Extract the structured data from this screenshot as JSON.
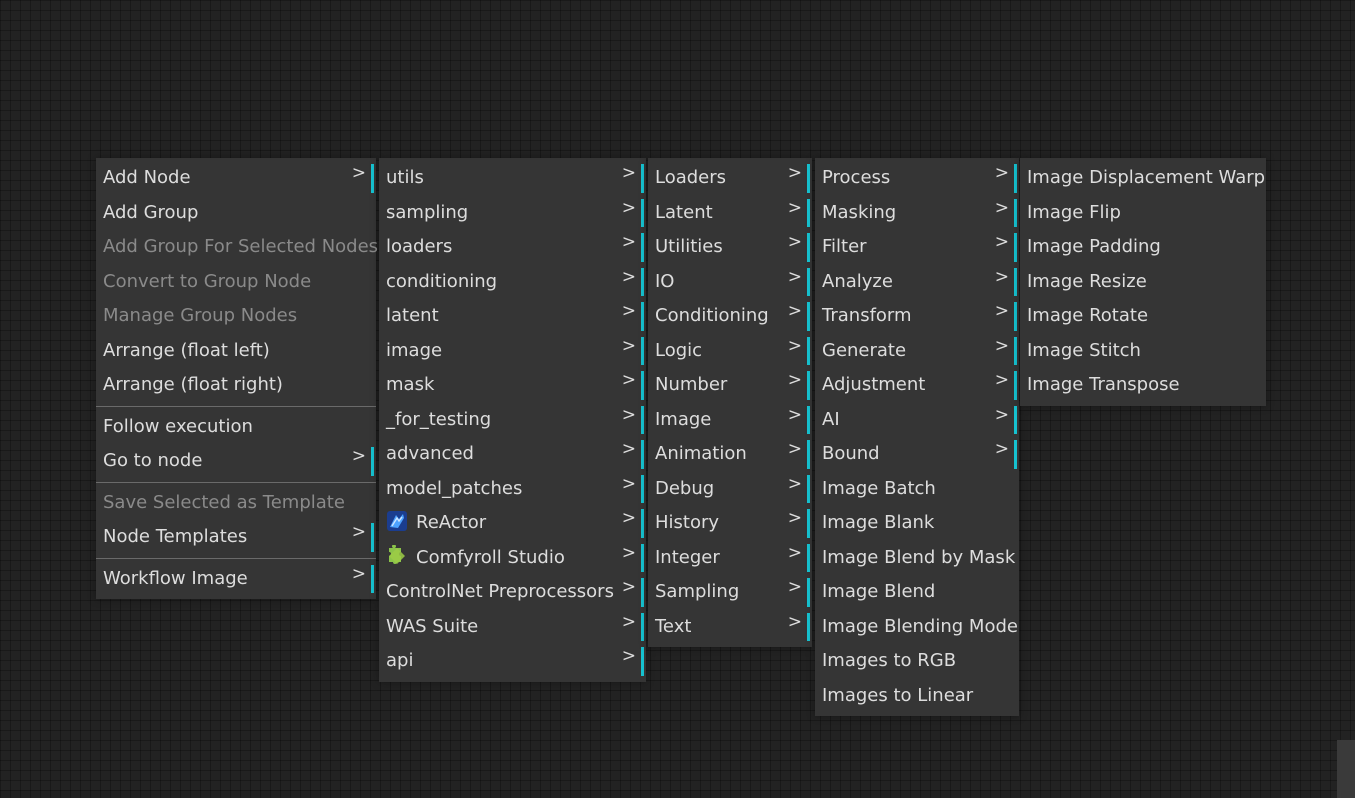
{
  "colors": {
    "background": "#222222",
    "menu_bg": "#353535",
    "text": "#dddddd",
    "disabled_text": "#8a8a8a",
    "submenu_accent": "#16c2d0"
  },
  "submenu_arrow": ">",
  "context_menu": {
    "items": [
      {
        "label": "Add Node"
      },
      {
        "label": "Add Group"
      },
      {
        "label": "Add Group For Selected Nodes"
      },
      {
        "label": "Convert to Group Node"
      },
      {
        "label": "Manage Group Nodes"
      },
      {
        "label": "Arrange (float left)"
      },
      {
        "label": "Arrange (float right)"
      },
      {
        "label": "Follow execution"
      },
      {
        "label": "Go to node"
      },
      {
        "label": "Save Selected as Template"
      },
      {
        "label": "Node Templates"
      },
      {
        "label": "Workflow Image"
      }
    ]
  },
  "categories_menu": {
    "items": [
      {
        "label": "utils"
      },
      {
        "label": "sampling"
      },
      {
        "label": "loaders"
      },
      {
        "label": "conditioning"
      },
      {
        "label": "latent"
      },
      {
        "label": "image"
      },
      {
        "label": "mask"
      },
      {
        "label": "_for_testing"
      },
      {
        "label": "advanced"
      },
      {
        "label": "model_patches"
      },
      {
        "label": "ReActor",
        "icon": "reactor-icon"
      },
      {
        "label": "Comfyroll Studio",
        "icon": "puzzle-icon"
      },
      {
        "label": "ControlNet Preprocessors"
      },
      {
        "label": "WAS Suite"
      },
      {
        "label": "api"
      }
    ]
  },
  "was_menu": {
    "items": [
      {
        "label": "Loaders"
      },
      {
        "label": "Latent"
      },
      {
        "label": "Utilities"
      },
      {
        "label": "IO"
      },
      {
        "label": "Conditioning"
      },
      {
        "label": "Logic"
      },
      {
        "label": "Number"
      },
      {
        "label": "Image"
      },
      {
        "label": "Animation"
      },
      {
        "label": "Debug"
      },
      {
        "label": "History"
      },
      {
        "label": "Integer"
      },
      {
        "label": "Sampling"
      },
      {
        "label": "Text"
      }
    ]
  },
  "image_menu": {
    "items": [
      {
        "label": "Process"
      },
      {
        "label": "Masking"
      },
      {
        "label": "Filter"
      },
      {
        "label": "Analyze"
      },
      {
        "label": "Transform"
      },
      {
        "label": "Generate"
      },
      {
        "label": "Adjustment"
      },
      {
        "label": "AI"
      },
      {
        "label": "Bound"
      },
      {
        "label": "Image Batch"
      },
      {
        "label": "Image Blank"
      },
      {
        "label": "Image Blend by Mask"
      },
      {
        "label": "Image Blend"
      },
      {
        "label": "Image Blending Mode"
      },
      {
        "label": "Images to RGB"
      },
      {
        "label": "Images to Linear"
      }
    ]
  },
  "transform_menu": {
    "items": [
      {
        "label": "Image Displacement Warp"
      },
      {
        "label": "Image Flip"
      },
      {
        "label": "Image Padding"
      },
      {
        "label": "Image Resize"
      },
      {
        "label": "Image Rotate"
      },
      {
        "label": "Image Stitch"
      },
      {
        "label": "Image Transpose"
      }
    ]
  }
}
